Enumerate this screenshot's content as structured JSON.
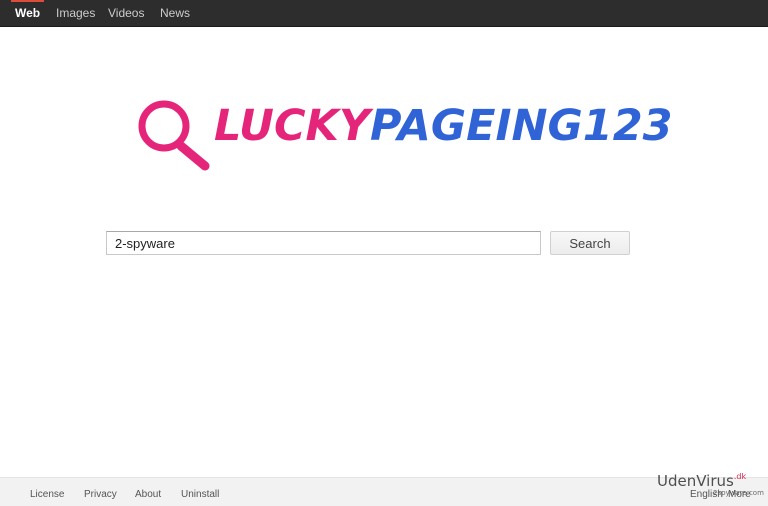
{
  "nav": {
    "items": [
      {
        "label": "Web"
      },
      {
        "label": "Images"
      },
      {
        "label": "Videos"
      },
      {
        "label": "News"
      }
    ],
    "accent": "#dd4b39"
  },
  "logo": {
    "part1": "LUCKY",
    "part2": "PAGEING123",
    "pink": "#e5257a",
    "blue": "#2f63d6",
    "icon": "magnifier-icon"
  },
  "search": {
    "value": "2-spyware",
    "button_label": "Search"
  },
  "footer": {
    "links": [
      {
        "label": "License"
      },
      {
        "label": "Privacy"
      },
      {
        "label": "About"
      },
      {
        "label": "Uninstall"
      }
    ],
    "language": "English",
    "more": "More"
  },
  "watermark": {
    "text": "UdenVirus",
    "suffix": ".dk",
    "sub": "2spyware.com"
  }
}
